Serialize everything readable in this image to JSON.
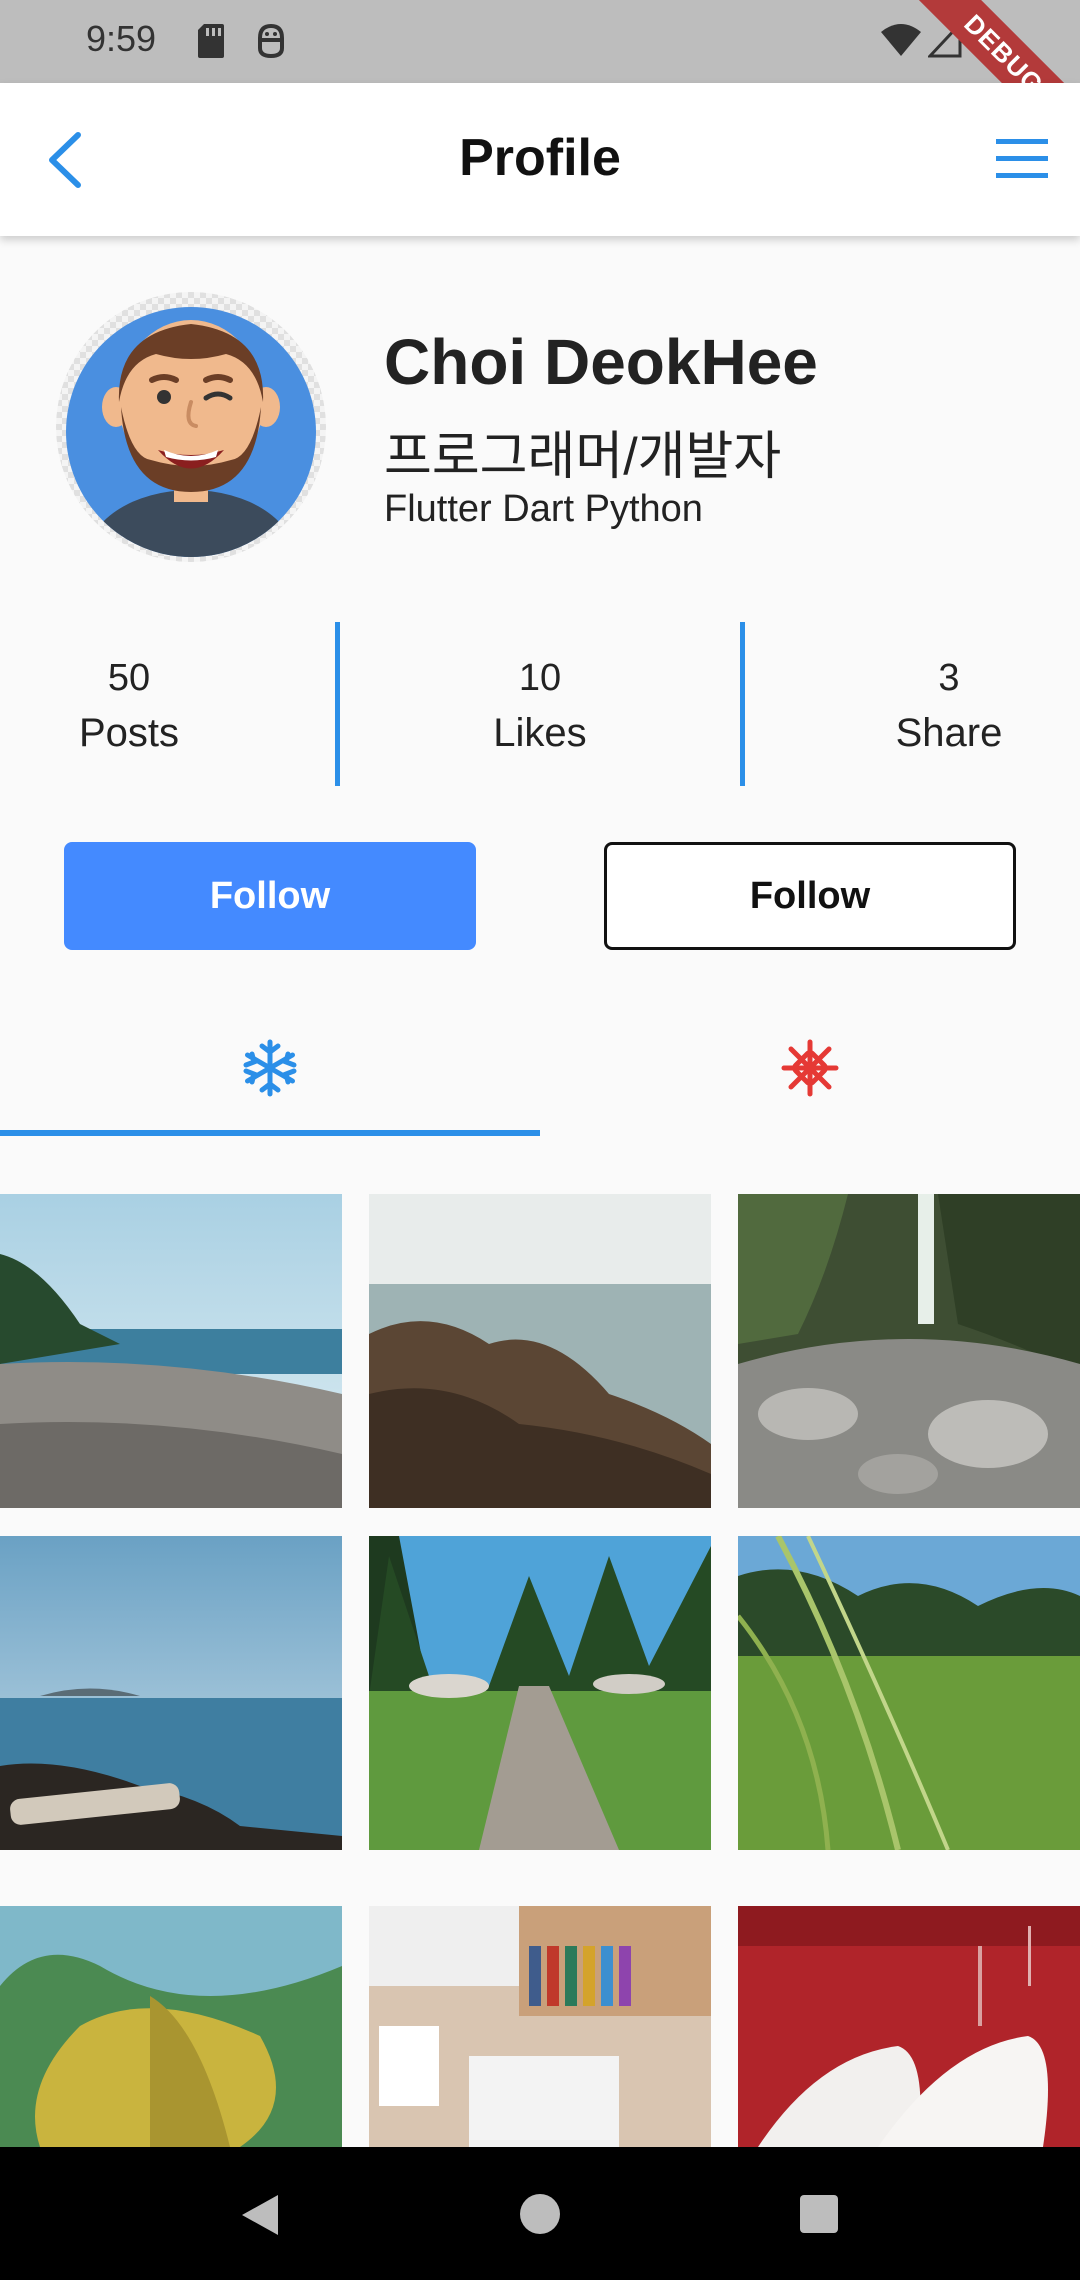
{
  "status_bar": {
    "time": "9:59",
    "debug_label": "DEBUG",
    "icons": [
      "sd-card-icon",
      "android-debug-icon",
      "wifi-icon",
      "signal-icon",
      "battery-icon"
    ]
  },
  "app_bar": {
    "title": "Profile",
    "back_icon": "chevron-left-icon",
    "menu_icon": "hamburger-menu-icon",
    "accent": "#2b8fe8"
  },
  "profile": {
    "name": "Choi DeokHee",
    "role": "프로그래머/개발자",
    "skills": "Flutter Dart Python",
    "avatar_icon": "avatar-bearded-man"
  },
  "stats": [
    {
      "value": "50",
      "label": "Posts"
    },
    {
      "value": "10",
      "label": "Likes"
    },
    {
      "value": "3",
      "label": "Share"
    }
  ],
  "buttons": {
    "primary_label": "Follow",
    "outline_label": "Follow",
    "primary_color": "#448aff"
  },
  "tabs": [
    {
      "icon": "snowflake-icon",
      "color": "#2b8fe8",
      "selected": true
    },
    {
      "icon": "asterisk-icon",
      "color": "#e53935",
      "selected": false
    }
  ],
  "photos": [
    "beach-shore-photo",
    "rocky-coast-photo",
    "waterfall-photo",
    "ocean-rocks-photo",
    "forest-path-photo",
    "grass-field-photo",
    "mossy-tree-photo",
    "desk-books-photo",
    "white-shoes-photo"
  ],
  "nav_bar": {
    "back_icon": "nav-back-icon",
    "home_icon": "nav-home-icon",
    "recents_icon": "nav-recents-icon"
  }
}
